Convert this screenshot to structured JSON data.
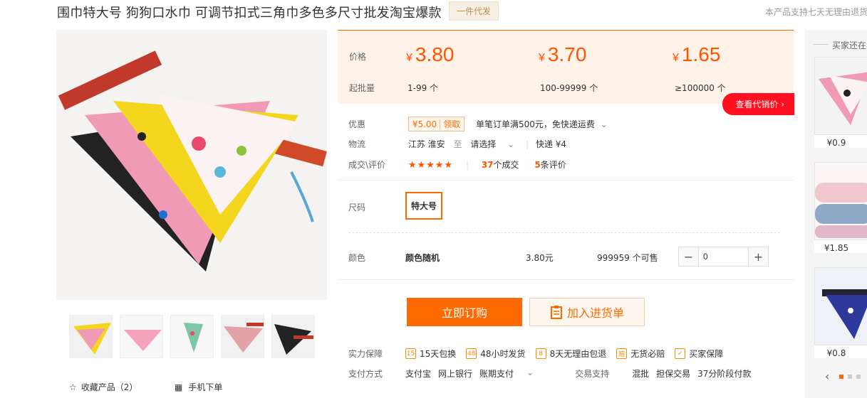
{
  "header": {
    "title": "围巾特大号 狗狗口水巾 可调节扣式三角巾多色多尺寸批发淘宝爆款",
    "badge": "一件代发",
    "note": "本产品支持七天无理由退货"
  },
  "gallery": {
    "thumbnails": [
      "thumb-1",
      "thumb-2",
      "thumb-3",
      "thumb-4",
      "thumb-5"
    ],
    "favorite_label": "收藏产品（2）",
    "mobile_label": "手机下单"
  },
  "pricing": {
    "price_label": "价格",
    "qty_label": "起批量",
    "currency": "¥",
    "tiers": [
      {
        "price": "3.80",
        "range": "1-99 个"
      },
      {
        "price": "3.70",
        "range": "100-99999 个"
      },
      {
        "price": "1.65",
        "range": "≥100000 个"
      }
    ],
    "agent_button": "查看代销价",
    "accent": "#ff6a00"
  },
  "promo": {
    "label": "优惠",
    "coupon_amount": "¥5.00",
    "coupon_action": "领取",
    "text": "单笔订单满500元，免快递运费"
  },
  "logistics": {
    "label": "物流",
    "from": "江苏 淮安",
    "to_word": "至",
    "select": "请选择",
    "method": "快递 ¥4"
  },
  "reviews": {
    "label": "成交\\评价",
    "stars": "★★★★★",
    "deals_count": "37",
    "deals_text": "个成交",
    "review_count": "5",
    "review_text": "条评价"
  },
  "size": {
    "label": "尺码",
    "selected": "特大号"
  },
  "color": {
    "label": "颜色",
    "value": "颜色随机",
    "price": "3.80元",
    "stock": "999959 个可售",
    "quantity": "0"
  },
  "actions": {
    "buy": "立即订购",
    "cart": "加入进货单"
  },
  "guarantee": {
    "label": "实力保障",
    "items": [
      "15天包换",
      "48小时发货",
      "8天无理由包退",
      "无货必赔",
      "买家保障"
    ]
  },
  "payment": {
    "label": "支付方式",
    "methods": [
      "支付宝",
      "网上银行",
      "账期支付"
    ],
    "trade_label": "交易支持",
    "trade_items": [
      "混批",
      "担保交易",
      "37分阶段付款"
    ]
  },
  "sidebar": {
    "title": "买家还在看",
    "items": [
      {
        "price": "¥0.9"
      },
      {
        "price": "¥1.85"
      },
      {
        "price": "¥0.8"
      }
    ]
  }
}
